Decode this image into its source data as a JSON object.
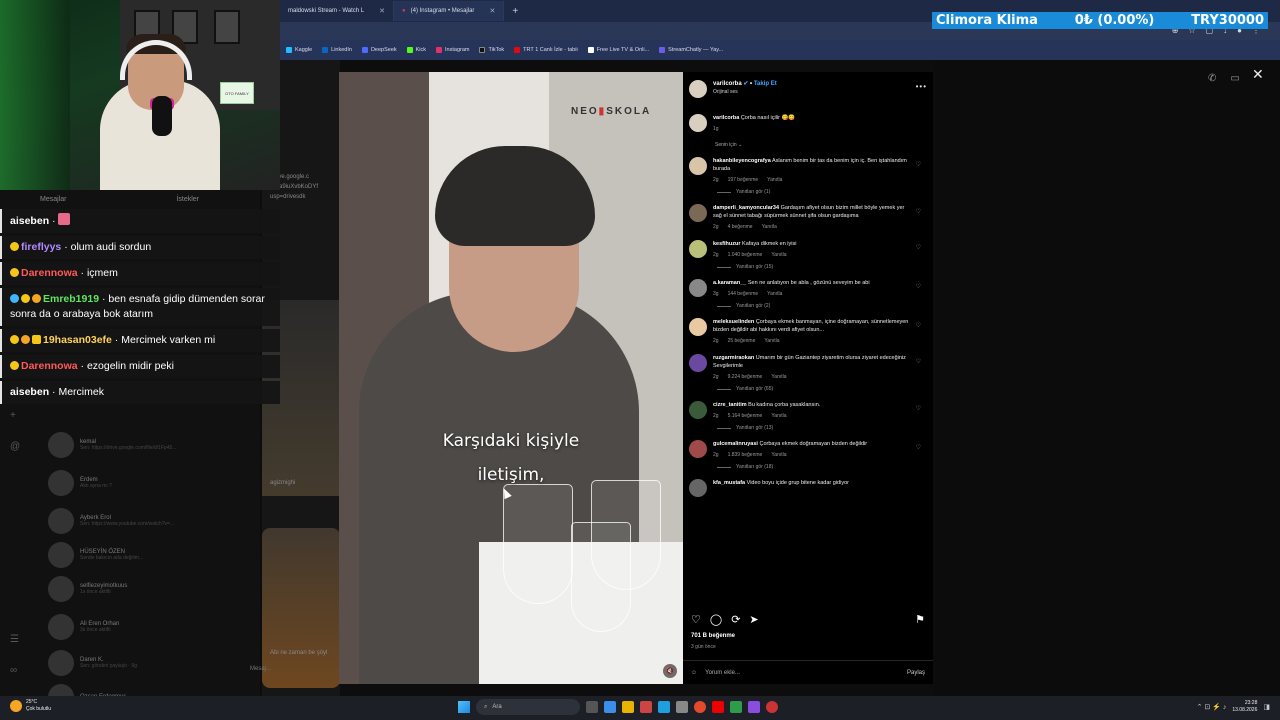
{
  "browser": {
    "tabs": [
      {
        "label": "maldowski Stream - Watch L",
        "active": false
      },
      {
        "label": "(4) Instagram • Mesajlar",
        "active": true
      }
    ],
    "new_tab": "+",
    "bookmarks": [
      {
        "label": "Kaggle",
        "color": "#20beff"
      },
      {
        "label": "LinkedIn",
        "color": "#0a66c2"
      },
      {
        "label": "DeepSeek",
        "color": "#4d6bfe"
      },
      {
        "label": "Kick",
        "color": "#53fc18"
      },
      {
        "label": "Instagram",
        "color": "#e1306c"
      },
      {
        "label": "TikTok",
        "color": "#111111"
      },
      {
        "label": "TRT 1 Canlı İzle - tabii",
        "color": "#e30613"
      },
      {
        "label": "Free Live TV & Onli...",
        "color": "#ffffff"
      },
      {
        "label": "StreamChatly — Yay...",
        "color": "#6c5ce7"
      }
    ]
  },
  "ticker": {
    "name": "Climora Klima",
    "change": "0₺ (0.00%)",
    "target": "TRY30000"
  },
  "instagram_bg": {
    "dm_tabs": [
      "Mesajlar",
      "İstekler"
    ],
    "conversations": [
      {
        "name": "kemal",
        "preview": "Sen: https://drive.google.com/file/d/1Fp45..."
      },
      {
        "name": "Erdem",
        "preview": "Aktı ayna mı ?"
      },
      {
        "name": "Ayberk Erol",
        "preview": "Sen: https://www.youtube.com/watch?v=..."
      },
      {
        "name": "HÜSEYİN ÖZEN",
        "preview": "Sende bakıcın ada değilim..."
      },
      {
        "name": "selfiezeyimotkuus",
        "preview": "1s önce aktifti"
      },
      {
        "name": "Ali Eren Orhan",
        "preview": "3s önce aktifti"
      },
      {
        "name": "Daren K.",
        "preview": "Sen: gönderi paylaştı · 9g"
      },
      {
        "name": "Ozcan Erdogmus",
        "preview": ""
      }
    ],
    "chat_texts": [
      "/drive.google.c",
      "W1a9iuXvbKoDYf",
      "usp=drivesdk"
    ],
    "chat_user": "agizmighi",
    "composer_placeholder": "Mesaj...",
    "last_msg": "Abi ne zaman be şöyl"
  },
  "post": {
    "brand_left": "NEO",
    "brand_right": "SKOLA",
    "caption_line1": "Karşıdaki kişiyle",
    "caption_line2": "iletişim,",
    "author": "varilcorba",
    "follow": "Takip Et",
    "audio": "Orijinal ses",
    "description": "Çorba nasıl içilir",
    "desc_time": "1g",
    "for_you": "Senin için",
    "comments": [
      {
        "user": "hakanbileyencografya",
        "text": "Aslanım benim bir tas da benim için iç. Ben iştahlandım burada",
        "time": "2g",
        "likes": "197 beğenme",
        "reply": "Yanıtla",
        "replies": "Yanıtları gör (1)",
        "color": "#d8c5a8"
      },
      {
        "user": "damperli_kamyoncular34",
        "text": "Gardaşım afiyet olsun bizim millet böyle yemek yer sağ el sünnet tabağı süpürmek sünnet şifa olsun gardaşıma",
        "time": "2g",
        "likes": "4 beğenme",
        "reply": "Yanıtla",
        "replies": "",
        "color": "#7a6a55"
      },
      {
        "user": "kesfihuzur",
        "text": "Kafaya dikmek en iyisi",
        "time": "2g",
        "likes": "1.040 beğenme",
        "reply": "Yanıtla",
        "replies": "Yanıtları gör (15)",
        "color": "#b8c07a"
      },
      {
        "user": "a.karaman__",
        "text": "Sen ne anlatıyon be abla , gözünü seveyim be abi",
        "time": "3g",
        "likes": "144 beğenme",
        "reply": "Yanıtla",
        "replies": "Yanıtları gör (2)",
        "color": "#888888"
      },
      {
        "user": "meleksuelinden",
        "text": "Çorbaya ekmek banmayan, içine doğramayan, sünnetlemeyen bizden değildir abi hakkını verdi afiyet olsun...",
        "time": "2g",
        "likes": "25 beğenme",
        "reply": "Yanıtla",
        "replies": "",
        "color": "#e8c9a0"
      },
      {
        "user": "ruzgarmiraokan",
        "text": "Umarım bir gün Gaziantep ziyaretim olursa ziyaret edeceğiniz Sevgilerimle",
        "time": "2g",
        "likes": "9.224 beğenme",
        "reply": "Yanıtla",
        "replies": "Yanıtları gör (65)",
        "color": "#6a4aa0"
      },
      {
        "user": "cizre_tanitim",
        "text": "Bu kadına çorba yasaklansın.",
        "time": "2g",
        "likes": "5.164 beğenme",
        "reply": "Yanıtla",
        "replies": "Yanıtları gör (13)",
        "color": "#3a5a3a"
      },
      {
        "user": "gulcemalinruyasi",
        "text": "Çorbaya ekmek doğramayan bizden değildir",
        "time": "2g",
        "likes": "1.839 beğenme",
        "reply": "Yanıtla",
        "replies": "Yanıtları gör (18)",
        "color": "#a04a4a"
      },
      {
        "user": "kfa_mustafa",
        "text": "Video boyu içide grup bitene kadar gidiyor",
        "time": "",
        "likes": "",
        "reply": "",
        "replies": "",
        "color": "#666666"
      }
    ],
    "like_count": "701 B beğenme",
    "posted": "3 gün önce",
    "add_comment": "Yorum ekle...",
    "share": "Paylaş"
  },
  "stream_chat": [
    {
      "user": "aiseben",
      "color": "#ffffff",
      "text": "",
      "badges": [
        "#e66b8a"
      ]
    },
    {
      "user": "fireflyys",
      "color": "#b28bff",
      "text": "olum audi sordun",
      "badges": [
        "#f5c518"
      ]
    },
    {
      "user": "Darennowa",
      "color": "#ff5a5a",
      "text": "içmem",
      "badges": [
        "#f5c518"
      ]
    },
    {
      "user": "Emreb1919",
      "color": "#5ee65e",
      "text": "ben esnafa gidip dümenden sorar sonra da o arabaya bok atarım",
      "badges": [
        "#3fb4ff",
        "#f5c518",
        "#f5a623"
      ]
    },
    {
      "user": "19hasan03efe",
      "color": "#ffd25a",
      "text": "Mercimek varken mi",
      "badges": [
        "#f5c518",
        "#f5a623",
        "#f5c518"
      ]
    },
    {
      "user": "Darennowa",
      "color": "#ff5a5a",
      "text": "ezogelin midir peki",
      "badges": [
        "#f5c518"
      ]
    },
    {
      "user": "aiseben",
      "color": "#ffffff",
      "text": "Mercimek",
      "badges": []
    }
  ],
  "cam_sign": "OTO FAMILY",
  "taskbar": {
    "temp": "25°C",
    "weather": "Çok bulutlu",
    "search": "Ara",
    "time": "23:28",
    "date": "13.08.2026"
  }
}
